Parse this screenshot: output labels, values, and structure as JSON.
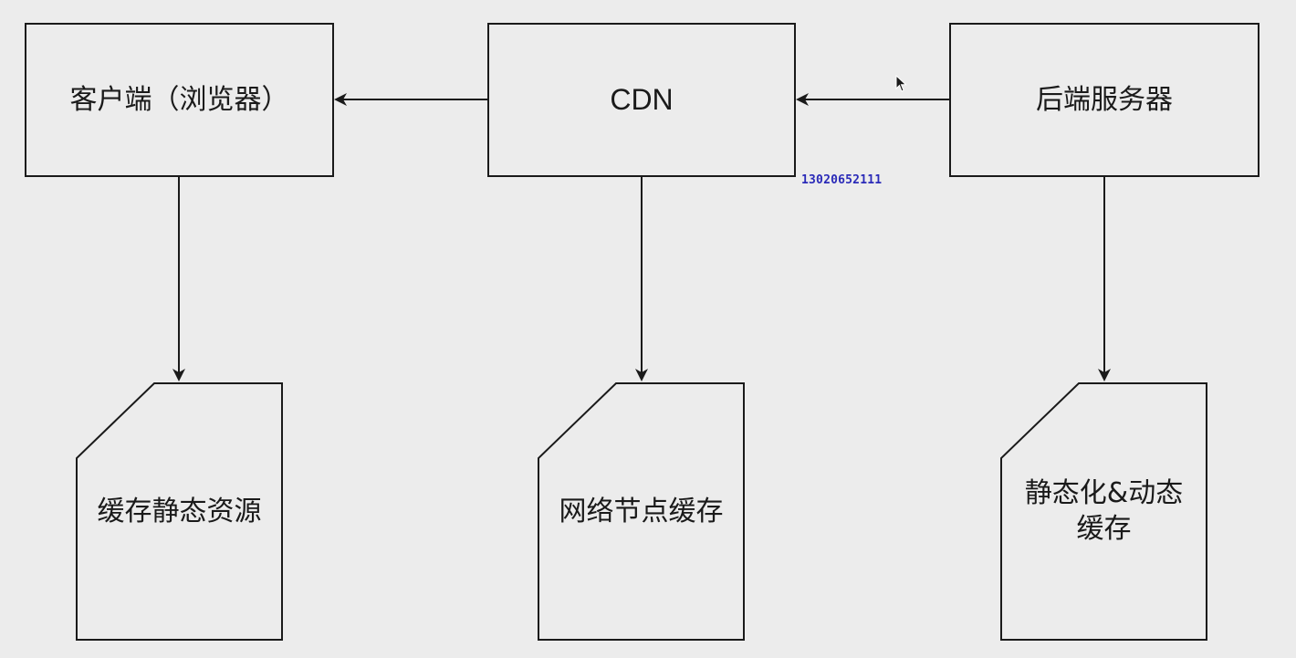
{
  "nodes": {
    "client": "客户端（浏览器）",
    "cdn": "CDN",
    "backend": "后端服务器",
    "client_cache": "缓存静态资源",
    "cdn_cache": "网络节点缓存",
    "backend_cache": "静态化&动态\n缓存"
  },
  "watermark": "13020652111",
  "icons": {
    "cursor": "mouse-pointer-icon"
  },
  "colors": {
    "background": "#ececec",
    "stroke": "#1a1a1a",
    "watermark": "#2a2ab8"
  }
}
